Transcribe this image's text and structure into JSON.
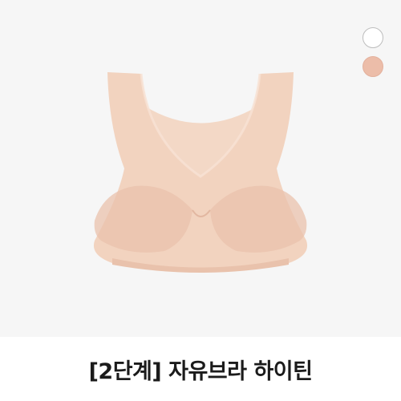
{
  "product": {
    "title": "[2단계] 자유브라 하이틴"
  },
  "color_swatches": [
    {
      "name": "white",
      "color": "#ffffff"
    },
    {
      "name": "beige",
      "color": "#ecbda9"
    }
  ],
  "colors": {
    "image_background": "#f6f6f6",
    "garment_base": "#f2d3bf",
    "garment_shadow": "#e9c2ac",
    "garment_inner": "#f3d8c6"
  },
  "icons": [
    "color-swatch-white",
    "color-swatch-beige"
  ]
}
